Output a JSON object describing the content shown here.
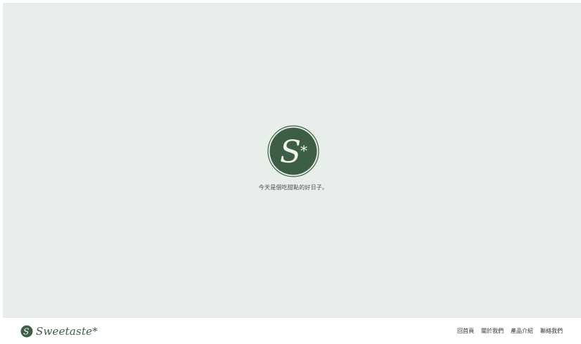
{
  "hero": {
    "tagline": "今天是個吃甜點的好日子。",
    "emblem": {
      "letter": "S",
      "mark": "*",
      "icon": "sweetaste-emblem-icon"
    }
  },
  "footer": {
    "brand": {
      "name": "Sweetaste*",
      "logo_letter": "S",
      "logo_icon": "sweetaste-logo-icon"
    },
    "nav": [
      {
        "label": "回首頁"
      },
      {
        "label": "關於我們"
      },
      {
        "label": "產品介紹"
      },
      {
        "label": "聯絡我們"
      }
    ]
  },
  "colors": {
    "hero_bg": "#e8eeea",
    "brand_green": "#3d5e45",
    "text": "#333333"
  }
}
